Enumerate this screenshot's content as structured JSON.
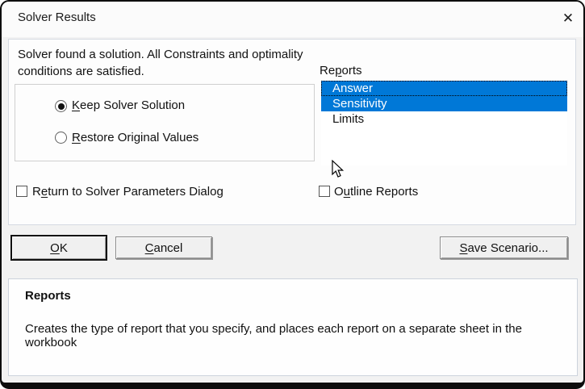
{
  "window": {
    "title": "Solver Results",
    "close_icon": "✕"
  },
  "main": {
    "message": "Solver found a solution.  All Constraints and optimality\nconditions are satisfied.",
    "reports_label": {
      "pre": "Re",
      "key": "p",
      "post": "orts"
    },
    "reports_list": [
      {
        "label": "Answer",
        "selected": true,
        "focused": true
      },
      {
        "label": "Sensitivity",
        "selected": true,
        "focused": false
      },
      {
        "label": "Limits",
        "selected": false,
        "focused": false
      }
    ],
    "radio_group": {
      "keep": {
        "pre": "",
        "key": "K",
        "post": "eep Solver Solution",
        "selected": true
      },
      "restore": {
        "pre": "",
        "key": "R",
        "post": "estore Original Values",
        "selected": false
      }
    },
    "checkbox_return": {
      "pre": "R",
      "key": "e",
      "post": "turn to Solver Parameters Dialog",
      "checked": false
    },
    "checkbox_outline": {
      "pre": "O",
      "key": "u",
      "post": "tline Reports",
      "checked": false
    }
  },
  "buttons": {
    "ok": {
      "pre": "",
      "key": "O",
      "post": "K"
    },
    "cancel": {
      "pre": "",
      "key": "C",
      "post": "ancel"
    },
    "save_scenario": {
      "pre": "",
      "key": "S",
      "post": "ave Scenario..."
    }
  },
  "footer": {
    "heading": "Reports",
    "description": "Creates the type of report that you specify, and places each report on a separate sheet in the workbook"
  },
  "colors": {
    "selection_blue": "#0078d7",
    "dialog_border": "#0d0d0d",
    "panel_background": "#fdfdfd"
  }
}
